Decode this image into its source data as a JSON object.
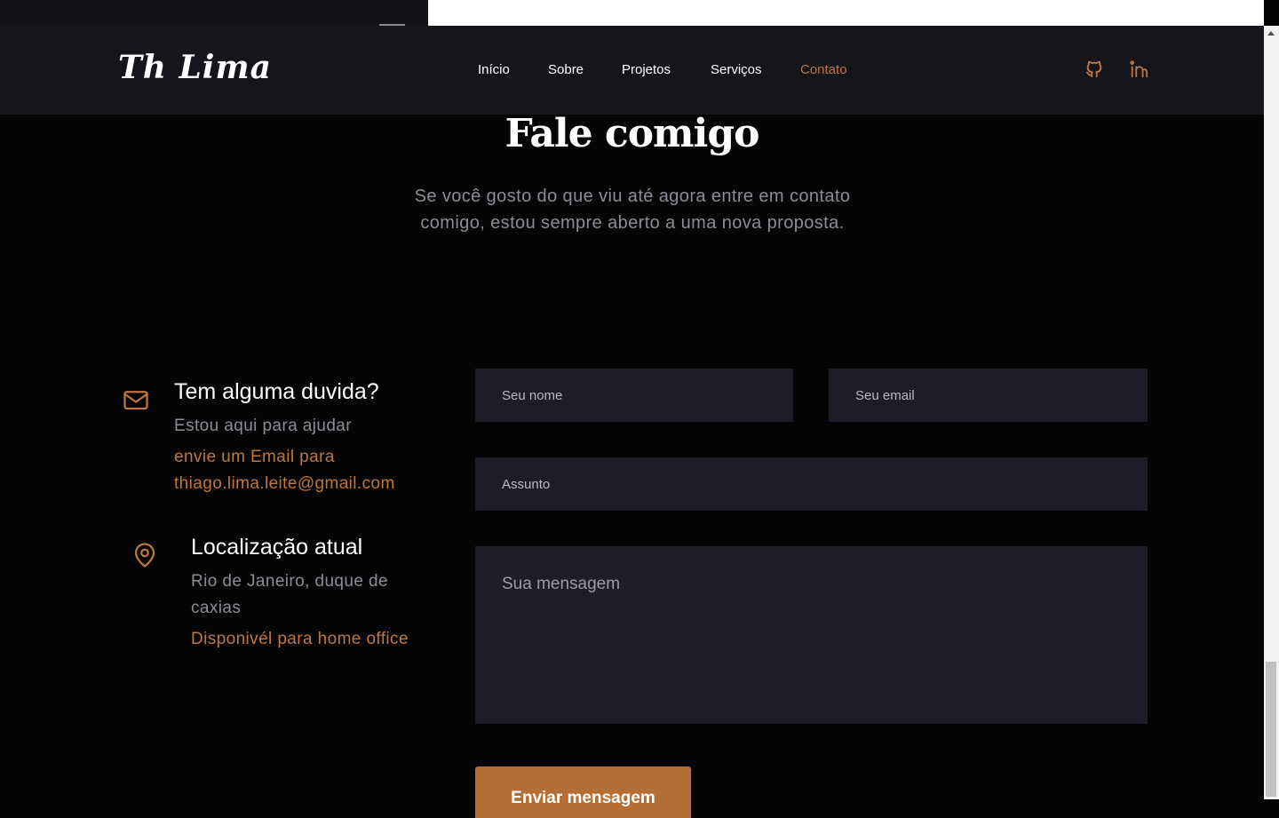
{
  "header": {
    "logo": "Th Lima",
    "nav": [
      {
        "label": "Início"
      },
      {
        "label": "Sobre"
      },
      {
        "label": "Projetos"
      },
      {
        "label": "Serviços"
      },
      {
        "label": "Contato",
        "active": true
      }
    ],
    "social": [
      {
        "icon": "github-icon"
      },
      {
        "icon": "linkedin-icon"
      }
    ]
  },
  "contact": {
    "title": "Fale comigo",
    "subtitle": "Se você gosto do que viu até agora entre em contato comigo, estou sempre aberto a uma nova proposta.",
    "info": [
      {
        "icon": "mail-icon",
        "title": "Tem alguma duvida?",
        "text": "Estou aqui para ajudar",
        "accent": "envie um Email para thiago.lima.leite@gmail.com"
      },
      {
        "icon": "location-pin-icon",
        "title": "Localização atual",
        "text": "Rio de Janeiro, duque de caxias",
        "accent": "Disponivél para home office"
      }
    ],
    "form": {
      "name_placeholder": "Seu nome",
      "email_placeholder": "Seu email",
      "subject_placeholder": "Assunto",
      "message_placeholder": "Sua mensagem",
      "submit_label": "Enviar mensagem"
    }
  },
  "colors": {
    "accent": "#c0763d",
    "button": "#b56f35",
    "background": "#050505",
    "header_bg": "#15161c",
    "field_bg": "#1c1d26"
  }
}
